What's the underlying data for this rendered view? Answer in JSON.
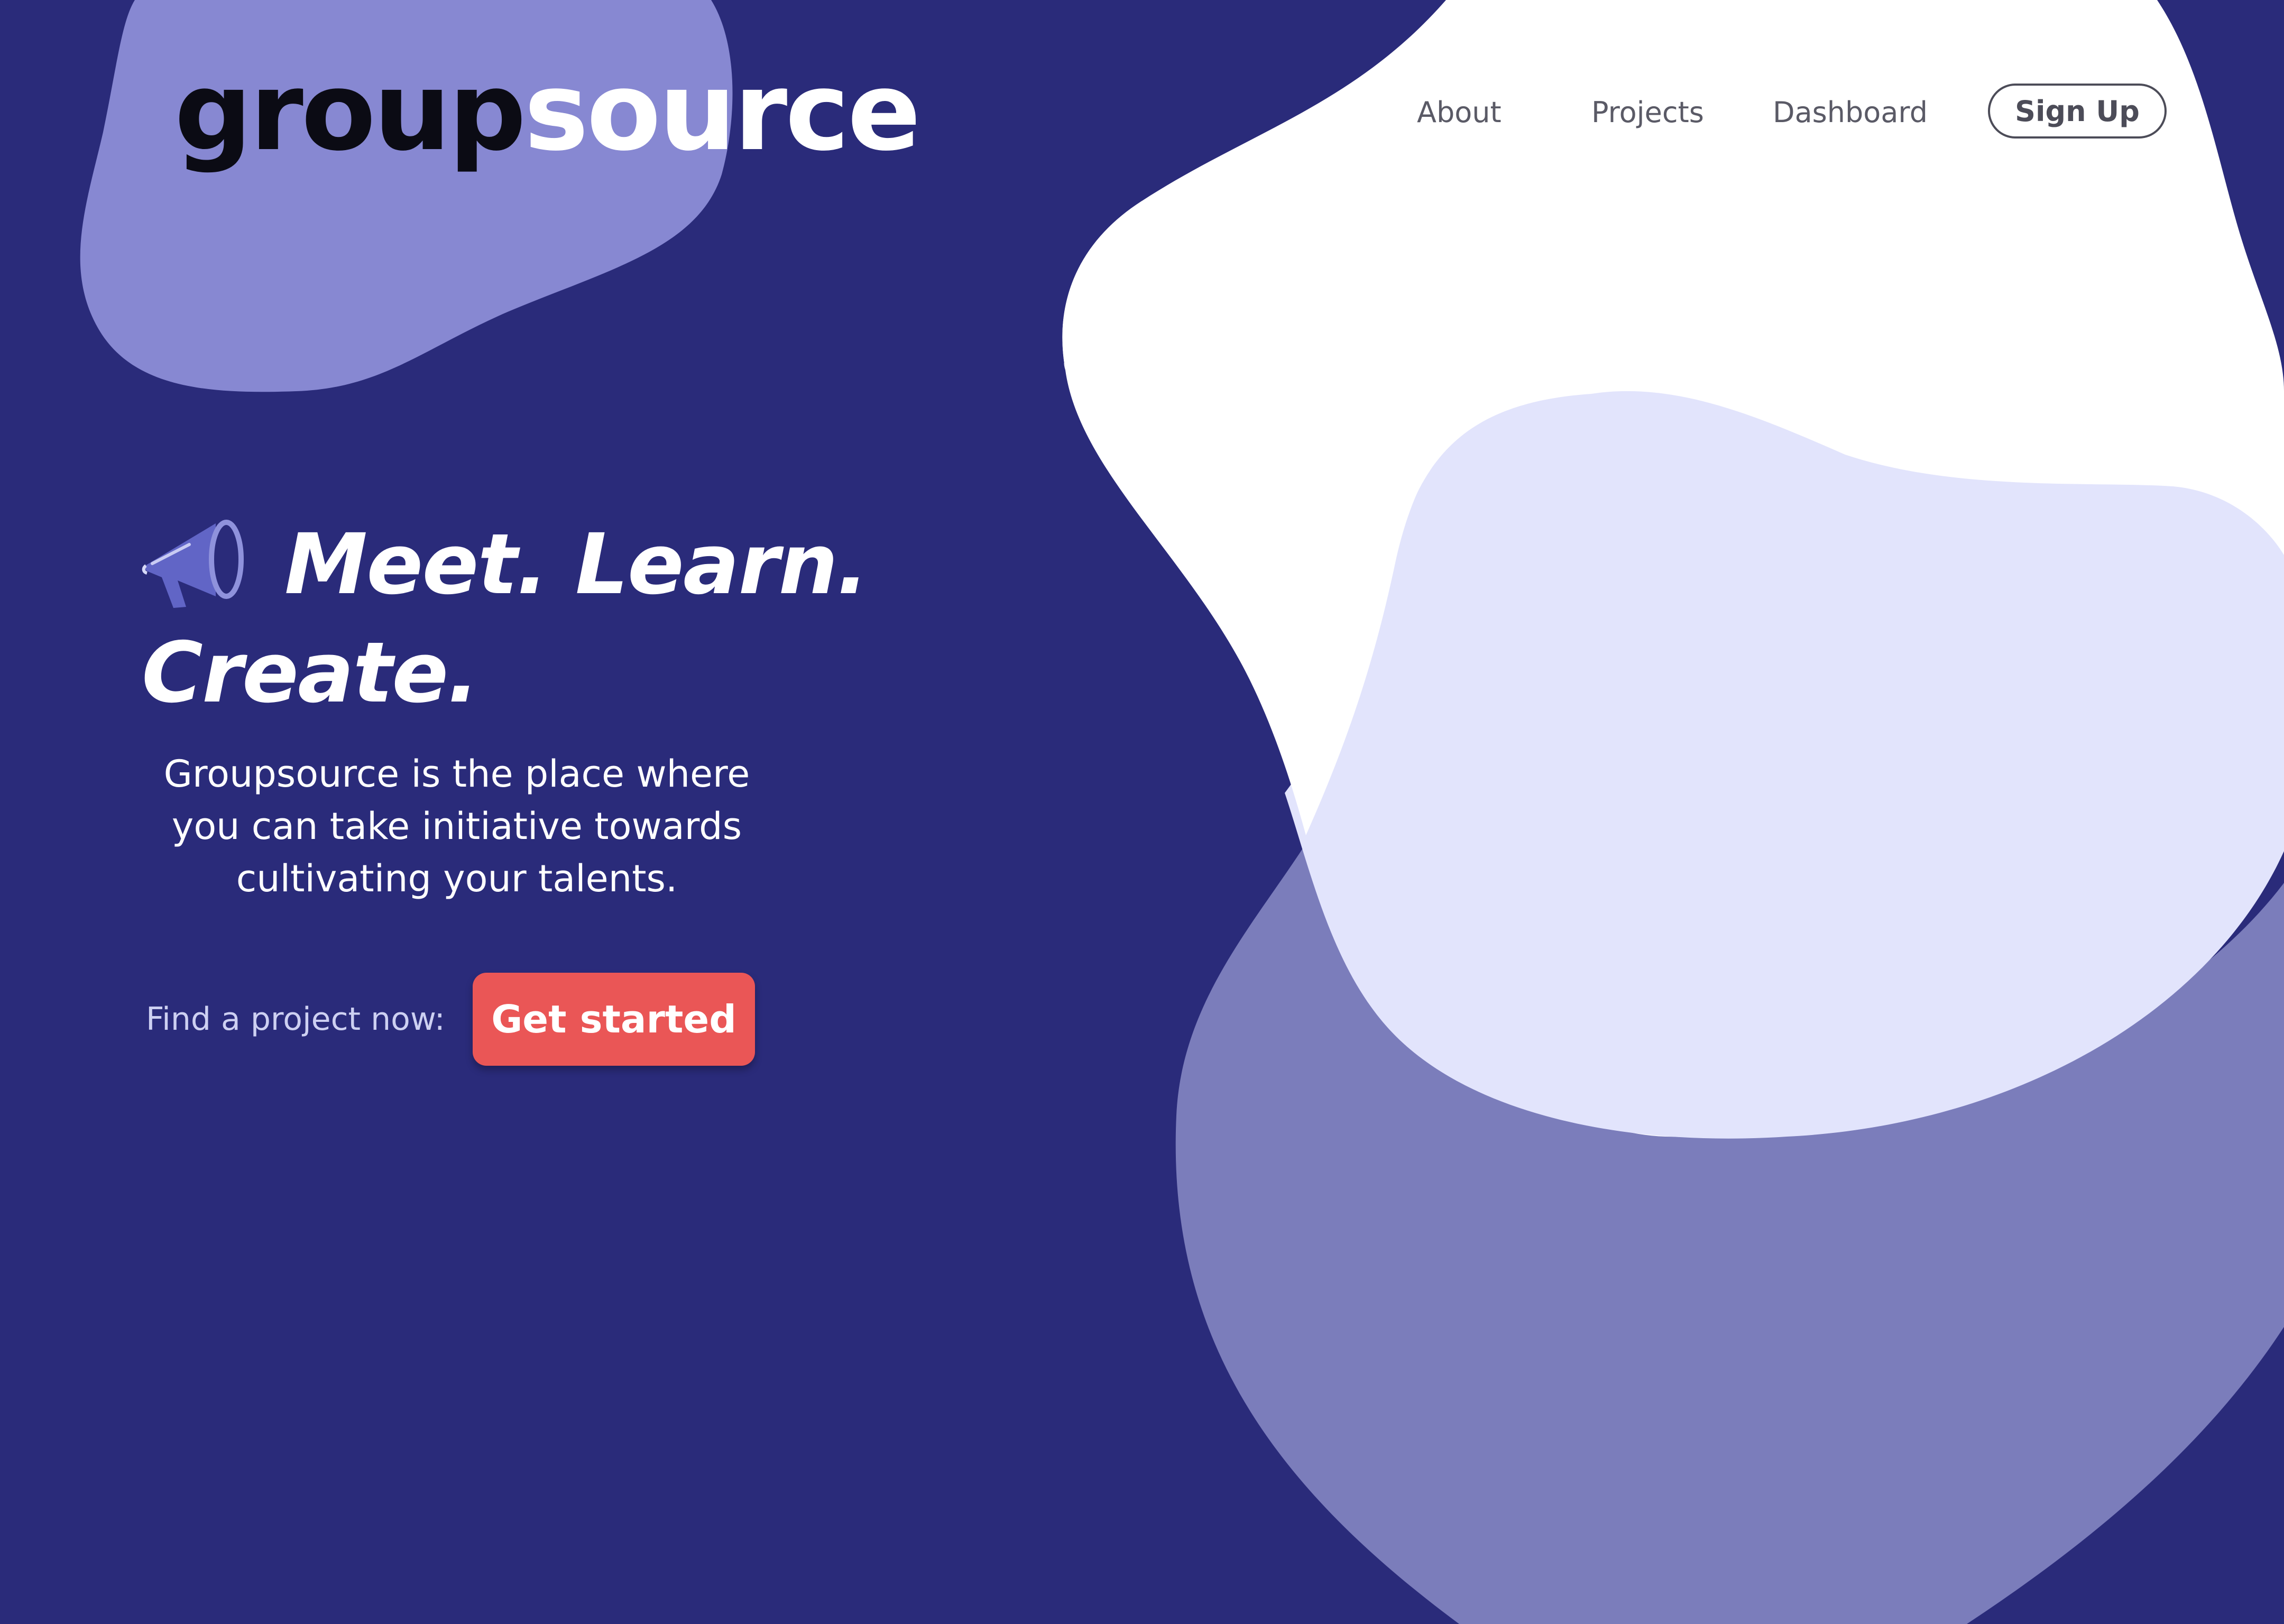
{
  "brand": {
    "logo_part_1": "group",
    "logo_part_2": "source"
  },
  "nav": {
    "items": [
      {
        "label": "About"
      },
      {
        "label": "Projects"
      },
      {
        "label": "Dashboard"
      }
    ],
    "signup_label": "Sign Up"
  },
  "hero": {
    "headline": "Meet. Learn. Create.",
    "description": "Groupsource is the place where you can take initiative towards cultivating your talents.",
    "cta_label": "Find a project now:",
    "cta_button": "Get started"
  },
  "colors": {
    "background": "#2a2b7a",
    "blob_periwinkle": "#8788d2",
    "blob_white": "#ffffff",
    "blob_lavender": "#e2e4fc",
    "blob_slate": "#7b7dbb",
    "accent_red": "#ea5656",
    "megaphone": "#6165c6"
  },
  "icons": {
    "megaphone": "megaphone-icon"
  }
}
